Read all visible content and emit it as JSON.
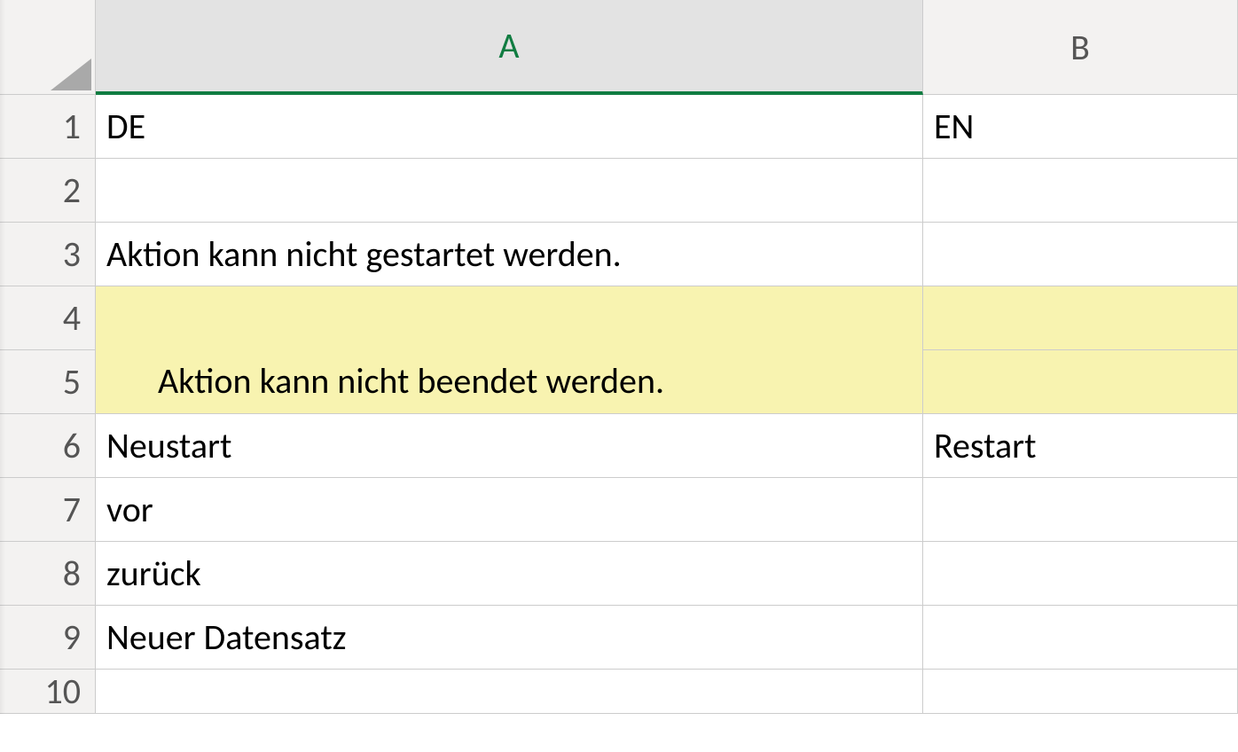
{
  "columns": {
    "A": "A",
    "B": "B"
  },
  "rowNumbers": [
    "1",
    "2",
    "3",
    "4",
    "5",
    "6",
    "7",
    "8",
    "9",
    "10"
  ],
  "sheet": {
    "row1": {
      "A": "DE",
      "B": "EN"
    },
    "row2": {
      "A": "",
      "B": ""
    },
    "row3": {
      "A": "Aktion kann nicht gestartet werden.",
      "B": ""
    },
    "row4_5_merged": {
      "A": "Aktion kann nicht beendet werden.",
      "B4": "",
      "B5": ""
    },
    "row6": {
      "A": "Neustart",
      "B": "Restart"
    },
    "row7": {
      "A": "vor",
      "B": ""
    },
    "row8": {
      "A": "zurück",
      "B": ""
    },
    "row9": {
      "A": "Neuer Datensatz",
      "B": ""
    },
    "row10": {
      "A": "",
      "B": ""
    }
  },
  "highlightColor": "#f8f3b0",
  "selection": {
    "activeCell": "A1",
    "selectedColumn": "A"
  }
}
